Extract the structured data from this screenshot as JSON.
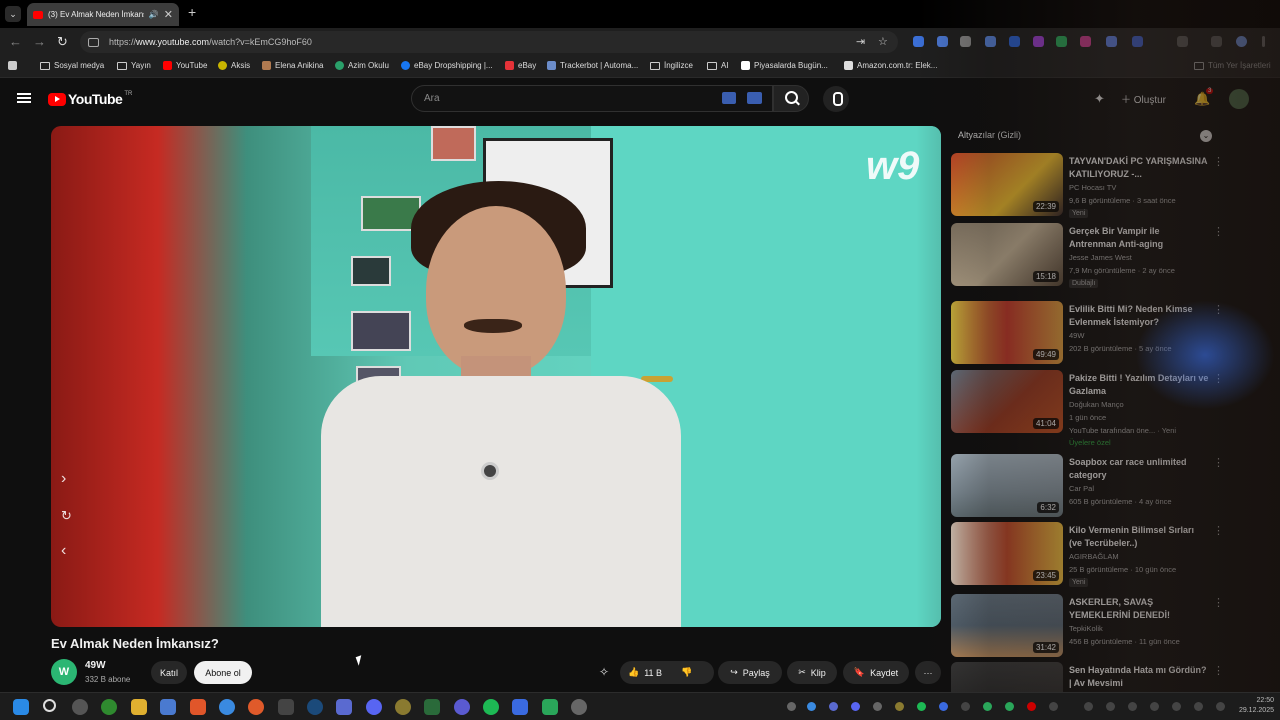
{
  "browser": {
    "tab_title": "(3) Ev Almak Neden İmkansız?",
    "url_prefix": "https://",
    "url_host": "www.youtube.com",
    "url_path": "/watch?v=kEmCG9hoF60",
    "new_tab": "+",
    "tab_close": "✕",
    "speaker": "🔊",
    "tab_menu": "⌄"
  },
  "bookmarks": [
    {
      "label": "Sosyal medya",
      "icon": "folder-icon",
      "color": "#cccccc"
    },
    {
      "label": "Yayın",
      "icon": "folder-icon",
      "color": "#cccccc"
    },
    {
      "label": "YouTube",
      "icon": "youtube-icon",
      "color": "#ff0000"
    },
    {
      "label": "Aksis",
      "icon": "aksis-icon",
      "color": "#c8b400"
    },
    {
      "label": "Elena Anikina",
      "icon": "avatar-icon",
      "color": "#b07a50"
    },
    {
      "label": "Azim Okulu",
      "icon": "azim-icon",
      "color": "#2aa06a"
    },
    {
      "label": "eBay Dropshipping |...",
      "icon": "facebook-icon",
      "color": "#1877f2"
    },
    {
      "label": "eBay",
      "icon": "ebay-icon",
      "color": "#e53238"
    },
    {
      "label": "Trackerbot | Automa...",
      "icon": "trackerbot-icon",
      "color": "#6b8cc9"
    },
    {
      "label": "İngilizce",
      "icon": "folder-icon",
      "color": "#cccccc"
    },
    {
      "label": "AI",
      "icon": "folder-icon",
      "color": "#cccccc"
    },
    {
      "label": "Piyasalarda Bugün...",
      "icon": "yt-icon",
      "color": "#ffffff"
    },
    {
      "label": "Amazon.com.tr: Elek...",
      "icon": "amazon-icon",
      "color": "#dddddd"
    },
    {
      "label": "Tüm Yer İşaretleri",
      "icon": "folder-icon",
      "color": "#999999"
    }
  ],
  "youtube": {
    "logo_text": "YouTube",
    "country": "TR",
    "search_placeholder": "Ara",
    "create_label": "Oluştur",
    "notif_count": "3"
  },
  "video": {
    "title": "Ev Almak Neden İmkansız?",
    "watermark": "w9",
    "channel_initial": "W",
    "channel_name": "49W",
    "subscribers": "332 B abone",
    "join_label": "Katıl",
    "subscribe_label": "Abone ol",
    "likes": "11 B",
    "share_label": "Paylaş",
    "clip_label": "Klip",
    "save_label": "Kaydet",
    "more_label": "···"
  },
  "sidebar": {
    "header": "Altyazılar (Gizli)",
    "items": [
      {
        "title": "TAYVAN'DAKİ PC YARIŞMASINA KATILIYORUZ -...",
        "channel": "PC Hocası TV",
        "meta": "9,6 B görüntüleme · 3 saat önce",
        "tag": "Yeni",
        "duration": "22:39",
        "thumb_color": "#b8322a"
      },
      {
        "title": "Gerçek Bir Vampir ile Antrenman Anti-aging",
        "channel": "Jesse James West",
        "meta": "7,9 Mn görüntüleme · 2 ay önce",
        "tag": "Dublajlı",
        "duration": "15:18",
        "thumb_color": "#8a7d6a"
      },
      {
        "title": "Evlilik Bitti Mi? Neden Kimse Evlenmek İstemiyor?",
        "channel": "49W",
        "meta": "202 B görüntüleme · 5 ay önce",
        "tag": "",
        "duration": "49:49",
        "thumb_color": "#c63a2c"
      },
      {
        "title": "Pakize Bitti ! Yazılım Detayları ve Gazlama",
        "channel": "Doğukan Manço",
        "meta": "1 gün önce",
        "tag": "YouTube tarafından öne... · Yeni",
        "extra": "Üyelere özel",
        "duration": "41:04",
        "thumb_color": "#9a3a22"
      },
      {
        "title": "Soapbox car race unlimited category",
        "channel": "Car Pal",
        "meta": "605 B görüntüleme · 4 ay önce",
        "tag": "",
        "duration": "6:32",
        "thumb_color": "#8a9aa5"
      },
      {
        "title": "Kilo Vermenin Bilimsel Sırları (ve Tecrübeler..)",
        "channel": "AGIRBAĞLAM",
        "meta": "25 B görüntüleme · 10 gün önce",
        "tag": "Yeni",
        "duration": "23:45",
        "thumb_color": "#c24a2a"
      },
      {
        "title": "ASKERLER, SAVAŞ YEMEKLERİNİ DENEDİ!",
        "channel": "TepkiKolik",
        "meta": "456 B görüntüleme · 11 gün önce",
        "tag": "",
        "duration": "31:42",
        "thumb_color": "#5a6a78"
      },
      {
        "title": "Sen Hayatında Hata mı Gördün? | Av Mevsimi",
        "channel": "",
        "meta": "",
        "tag": "",
        "duration": "",
        "thumb_color": "#2a2a2a"
      }
    ]
  },
  "taskbar": {
    "clock_time": "22:50",
    "clock_date": "29.12.2025"
  }
}
